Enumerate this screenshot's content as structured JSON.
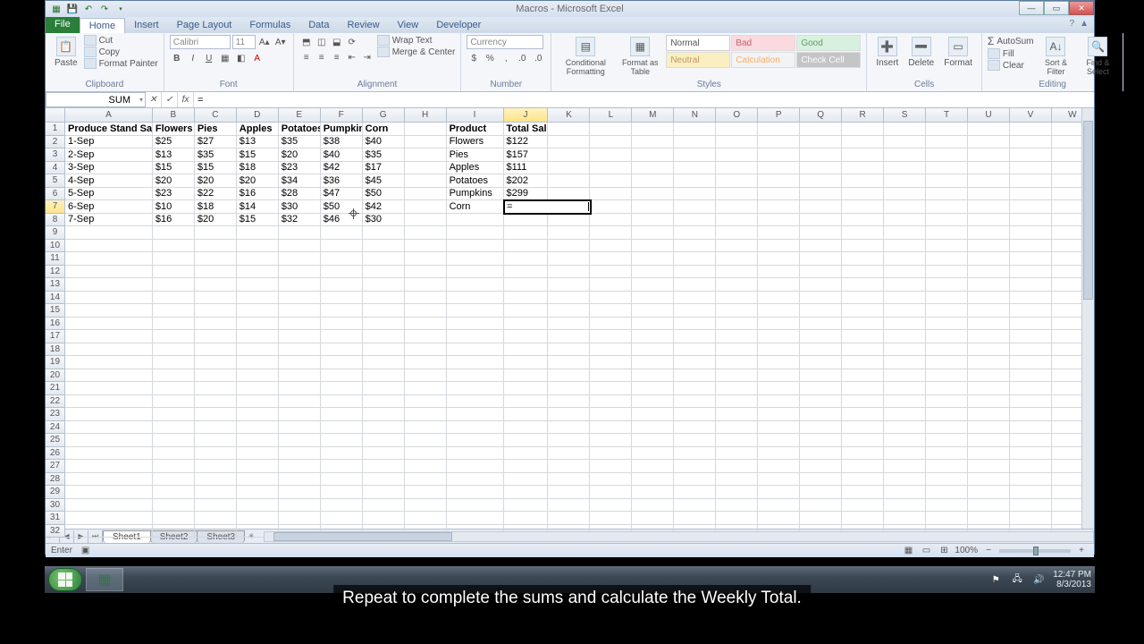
{
  "window": {
    "title": "Macros - Microsoft Excel"
  },
  "tabs": {
    "file": "File",
    "items": [
      "Home",
      "Insert",
      "Page Layout",
      "Formulas",
      "Data",
      "Review",
      "View",
      "Developer"
    ],
    "active": "Home"
  },
  "ribbon": {
    "clipboard": {
      "label": "Clipboard",
      "paste": "Paste",
      "cut": "Cut",
      "copy": "Copy",
      "painter": "Format Painter"
    },
    "font": {
      "label": "Font",
      "name": "Calibri",
      "size": "11"
    },
    "alignment": {
      "label": "Alignment",
      "wrap": "Wrap Text",
      "merge": "Merge & Center"
    },
    "number": {
      "label": "Number",
      "format": "Currency"
    },
    "styles": {
      "label": "Styles",
      "cond": "Conditional Formatting",
      "table": "Format as Table",
      "cells": {
        "normal": "Normal",
        "bad": "Bad",
        "good": "Good",
        "neutral": "Neutral",
        "calc": "Calculation",
        "check": "Check Cell"
      }
    },
    "cells": {
      "label": "Cells",
      "insert": "Insert",
      "delete": "Delete",
      "format": "Format"
    },
    "editing": {
      "label": "Editing",
      "autosum": "AutoSum",
      "fill": "Fill",
      "clear": "Clear",
      "sort": "Sort & Filter",
      "find": "Find & Select"
    }
  },
  "name_box": "SUM",
  "formula": "=",
  "columns": [
    "A",
    "B",
    "C",
    "D",
    "E",
    "F",
    "G",
    "H",
    "I",
    "J",
    "K",
    "L",
    "M",
    "N",
    "O",
    "P",
    "Q",
    "R",
    "S",
    "T",
    "U",
    "V",
    "W"
  ],
  "col_widths": {
    "A": 98,
    "default": 47,
    "I": 64,
    "J": 50
  },
  "selected_col": "J",
  "selected_row": 7,
  "active_cell": {
    "ref": "J7",
    "value": "="
  },
  "sheet_data": {
    "headers": [
      "Produce Stand Sales",
      "Flowers",
      "Pies",
      "Apples",
      "Potatoes",
      "Pumpkins",
      "Corn"
    ],
    "rows": [
      {
        "date": "1-Sep",
        "vals": [
          "$25",
          "$27",
          "$13",
          "$35",
          "$38",
          "$40"
        ]
      },
      {
        "date": "2-Sep",
        "vals": [
          "$13",
          "$35",
          "$15",
          "$20",
          "$40",
          "$35"
        ]
      },
      {
        "date": "3-Sep",
        "vals": [
          "$15",
          "$15",
          "$18",
          "$23",
          "$42",
          "$17"
        ]
      },
      {
        "date": "4-Sep",
        "vals": [
          "$20",
          "$20",
          "$20",
          "$34",
          "$36",
          "$45"
        ]
      },
      {
        "date": "5-Sep",
        "vals": [
          "$23",
          "$22",
          "$16",
          "$28",
          "$47",
          "$50"
        ]
      },
      {
        "date": "6-Sep",
        "vals": [
          "$10",
          "$18",
          "$14",
          "$30",
          "$50",
          "$42"
        ]
      },
      {
        "date": "7-Sep",
        "vals": [
          "$16",
          "$20",
          "$15",
          "$32",
          "$46",
          "$30"
        ]
      }
    ],
    "summary_header_product": "Product",
    "summary_header_total": "Total Sales",
    "summary": [
      {
        "product": "Flowers",
        "total": "$122"
      },
      {
        "product": "Pies",
        "total": "$157"
      },
      {
        "product": "Apples",
        "total": "$111"
      },
      {
        "product": "Potatoes",
        "total": "$202"
      },
      {
        "product": "Pumpkins",
        "total": "$299"
      },
      {
        "product": "Corn",
        "total": ""
      }
    ]
  },
  "sheets": [
    "Sheet1",
    "Sheet2",
    "Sheet3"
  ],
  "status": {
    "mode": "Enter",
    "zoom": "100%"
  },
  "taskbar": {
    "time": "12:47 PM",
    "date": "8/3/2013"
  },
  "caption": "Repeat to complete the sums and calculate the Weekly Total."
}
